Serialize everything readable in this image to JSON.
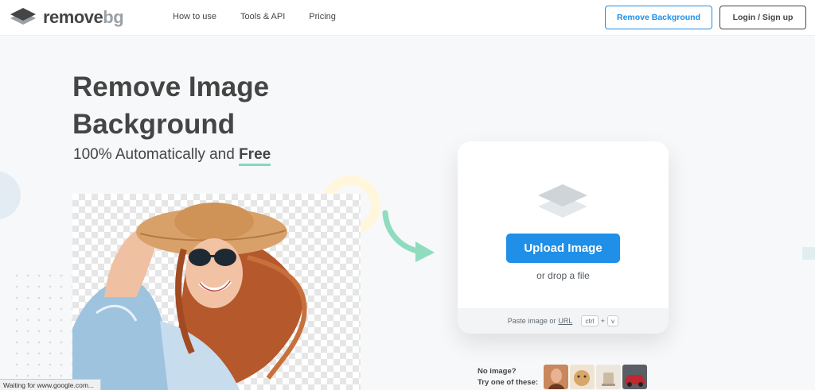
{
  "header": {
    "logo_word_a": "remove",
    "logo_word_b": "bg",
    "nav": [
      "How to use",
      "Tools & API",
      "Pricing"
    ],
    "remove_background_button": "Remove Background",
    "login_button": "Login / Sign up"
  },
  "hero": {
    "title_line1": "Remove Image",
    "title_line2": "Background",
    "subtitle_prefix": "100% Automatically and",
    "subtitle_emphasis": "Free"
  },
  "upload": {
    "button_label": "Upload Image",
    "drop_text": "or drop a file",
    "paste_text": "Paste image or",
    "paste_url": "URL",
    "key_ctrl": "ctrl",
    "key_plus": "+",
    "key_v": "v"
  },
  "samples": {
    "line1": "No image?",
    "line2": "Try one of these:",
    "thumbnails": [
      "woman-portrait-thumb",
      "dog-thumb",
      "cup-thumb",
      "red-car-thumb"
    ]
  },
  "status_bar": {
    "text": "Waiting for www.google.com..."
  },
  "colors": {
    "accent_blue": "#1f8fe8",
    "text_dark": "#454545",
    "free_underline": "#87d9b8",
    "arrow_green": "#8fdcbf"
  }
}
